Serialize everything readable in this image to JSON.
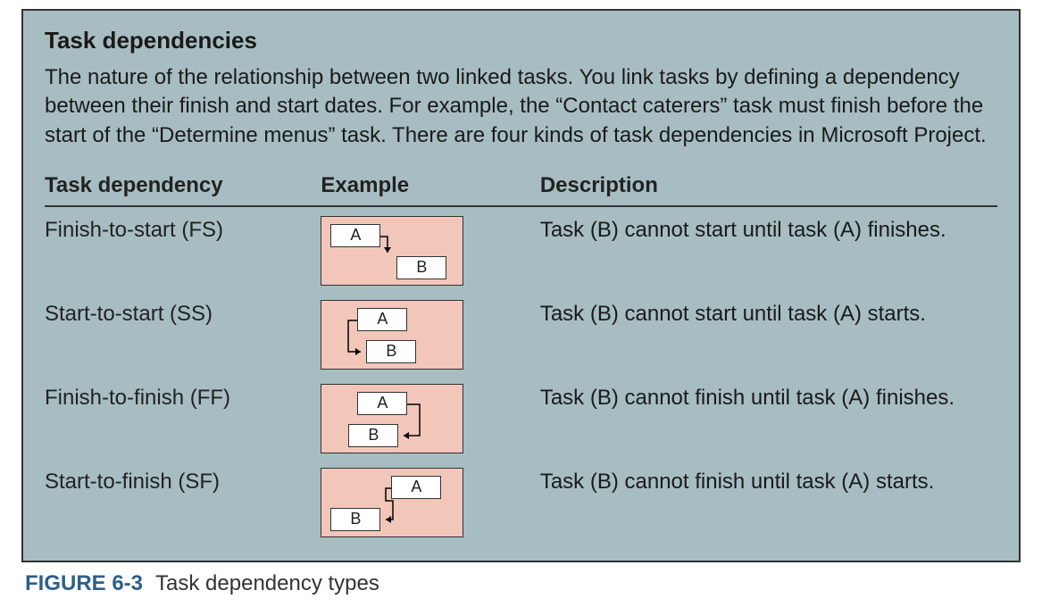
{
  "panel": {
    "title": "Task dependencies",
    "intro": "The nature of the relationship between two linked tasks. You link tasks by defining a dependency between their finish and start dates. For example, the “Contact caterers” task must finish before the start of the “Determine menus” task. There are four kinds of task dependencies in Microsoft Project."
  },
  "columns": {
    "dep": "Task dependency",
    "ex": "Example",
    "desc": "Description"
  },
  "labels": {
    "A": "A",
    "B": "B"
  },
  "rows": [
    {
      "name": "Finish-to-start (FS)",
      "desc": "Task (B) cannot start until task (A) finishes.",
      "diagram": "fs"
    },
    {
      "name": "Start-to-start (SS)",
      "desc": "Task (B) cannot start until task (A) starts.",
      "diagram": "ss"
    },
    {
      "name": "Finish-to-finish (FF)",
      "desc": "Task (B) cannot finish until task (A) finishes.",
      "diagram": "ff"
    },
    {
      "name": "Start-to-finish (SF)",
      "desc": "Task (B) cannot finish until task (A) starts.",
      "diagram": "sf"
    }
  ],
  "caption": {
    "num": "FIGURE 6-3",
    "text": "Task dependency types"
  }
}
